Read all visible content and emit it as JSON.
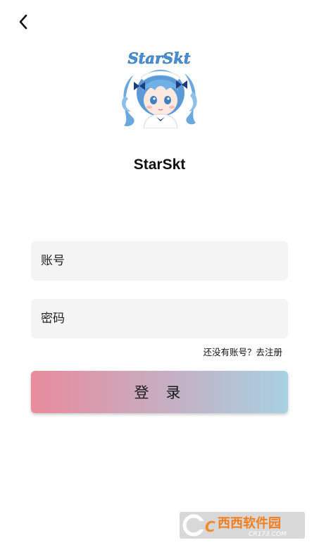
{
  "app": {
    "name": "StarSkt",
    "logo_text": "StarSkt"
  },
  "icons": {
    "back": "chevron-left-icon",
    "logo": "anime-maid-girl-logo",
    "watermark": "cr173-site-logo"
  },
  "form": {
    "account_placeholder": "账号",
    "password_placeholder": "密码",
    "register_prompt": "还没有账号？",
    "register_link": "去注册",
    "login_label": "登录"
  },
  "watermark": {
    "text": "西西软件园",
    "url_text": "CR173.COM"
  },
  "colors": {
    "background": "#ffffff",
    "field_bg": "#f4f4f4",
    "button_gradient_start": "#e88b9d",
    "button_gradient_end": "#a7d1e2",
    "logo_accent": "#5a9fd8"
  }
}
